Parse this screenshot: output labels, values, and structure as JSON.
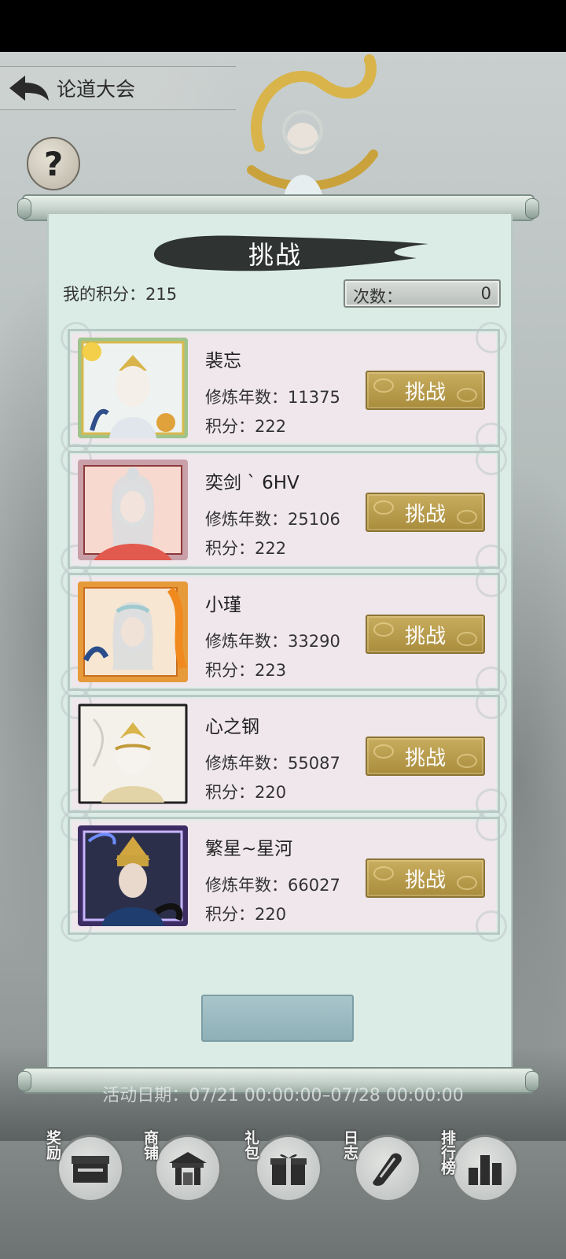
{
  "header": {
    "title": "论道大会"
  },
  "help": {
    "label": "?"
  },
  "panel": {
    "banner": "挑战",
    "my_score_label": "我的积分：",
    "my_score_value": "215",
    "count_label": "次数：",
    "count_value": "0"
  },
  "opponents": [
    {
      "name": "裴忘",
      "years_label": "修炼年数：",
      "years": "11375",
      "score_label": "积分：",
      "score": "222",
      "button": "挑战"
    },
    {
      "name": "奕剑 ` 6HV",
      "years_label": "修炼年数：",
      "years": "25106",
      "score_label": "积分：",
      "score": "222",
      "button": "挑战"
    },
    {
      "name": "小瑾",
      "years_label": "修炼年数：",
      "years": "33290",
      "score_label": "积分：",
      "score": "223",
      "button": "挑战"
    },
    {
      "name": "心之钢",
      "years_label": "修炼年数：",
      "years": "55087",
      "score_label": "积分：",
      "score": "220",
      "button": "挑战"
    },
    {
      "name": "繁星~星河",
      "years_label": "修炼年数：",
      "years": "66027",
      "score_label": "积分：",
      "score": "220",
      "button": "挑战"
    }
  ],
  "event": {
    "date_text": "活动日期：07/21 00:00:00–07/28 00:00:00"
  },
  "nav": [
    {
      "label": "奖励",
      "icon": "reward-chest-icon"
    },
    {
      "label": "商铺",
      "icon": "shop-pavilion-icon"
    },
    {
      "label": "礼包",
      "icon": "gift-box-icon"
    },
    {
      "label": "日志",
      "icon": "scroll-log-icon"
    },
    {
      "label": "排行榜",
      "icon": "ranking-bars-icon"
    }
  ],
  "colors": {
    "challenge_button": "#b69a4b",
    "panel_bg": "#dbece6",
    "row_bg": "#efe7ec",
    "refresh_button": "#9dbcc2"
  }
}
